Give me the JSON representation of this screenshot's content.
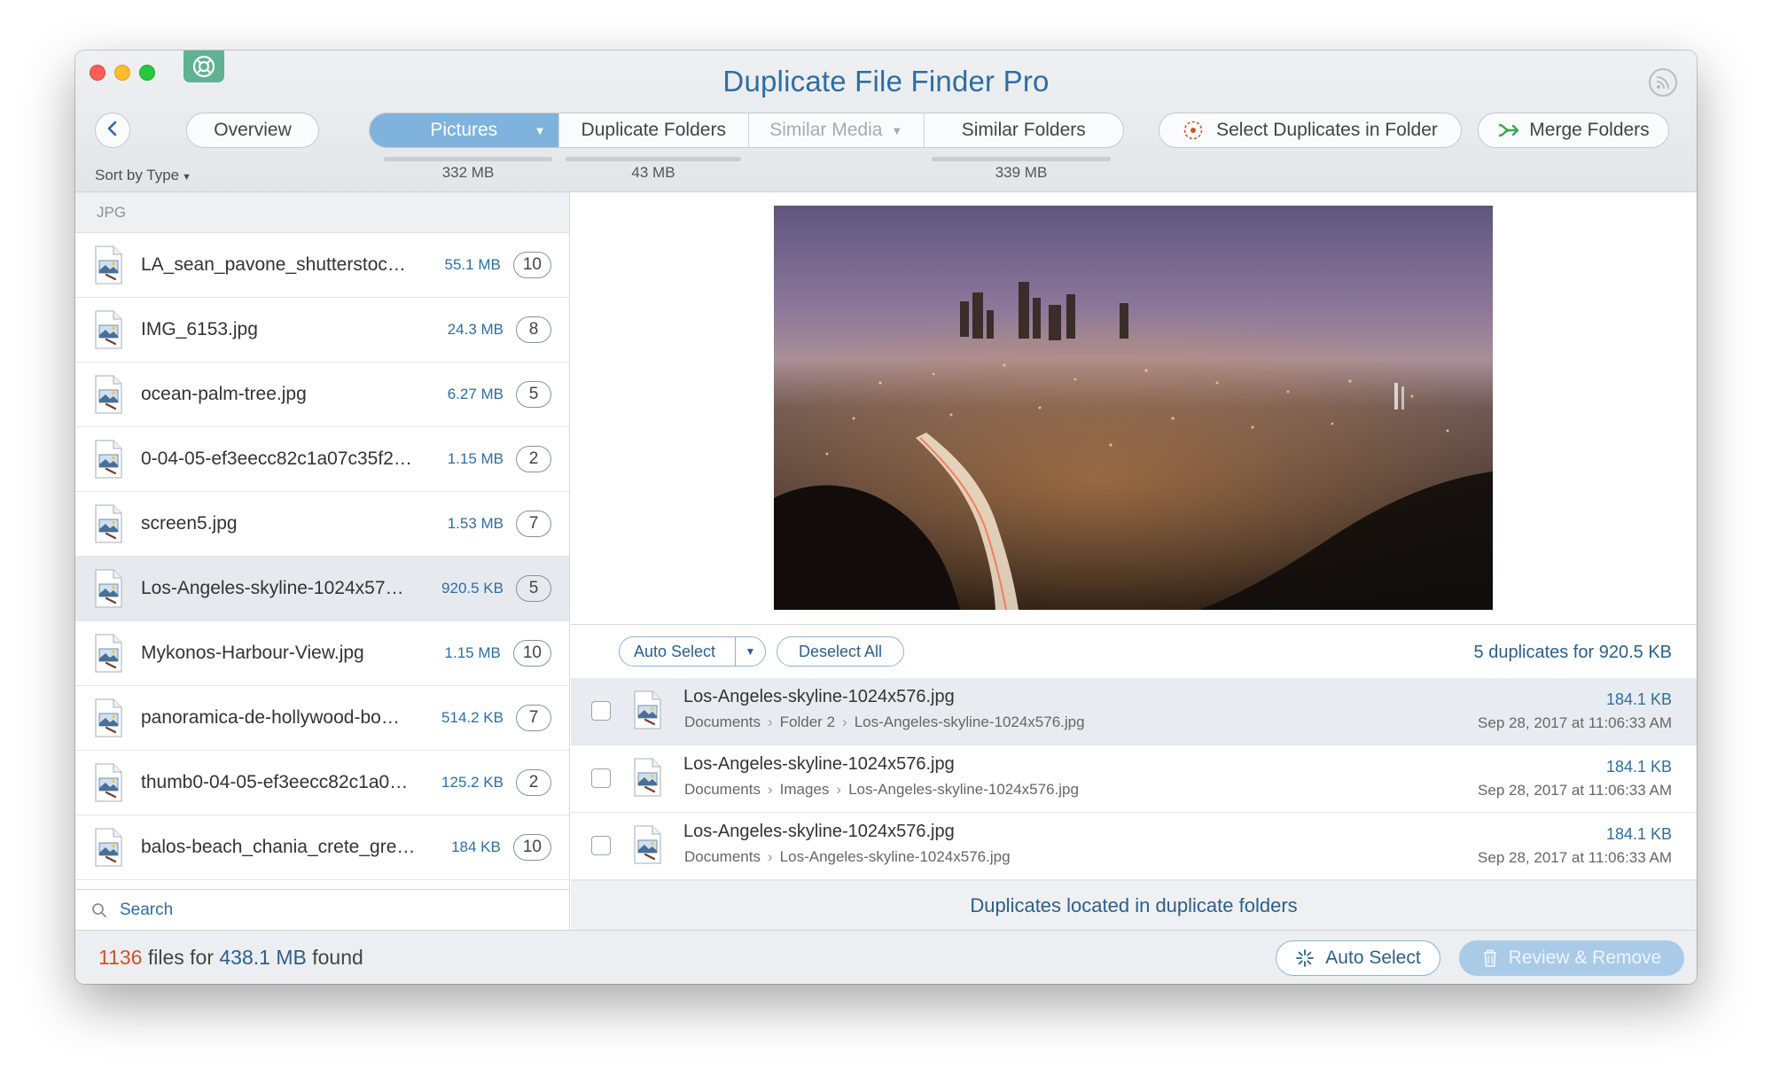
{
  "app": {
    "title": "Duplicate File Finder Pro"
  },
  "toolbar": {
    "overview_label": "Overview",
    "sort_label": "Sort by Type",
    "tabs": [
      {
        "label": "Pictures",
        "size": "332 MB",
        "has_dropdown": true,
        "state": "active"
      },
      {
        "label": "Duplicate Folders",
        "size": "43 MB",
        "has_dropdown": false,
        "state": "normal"
      },
      {
        "label": "Similar Media",
        "size": "",
        "has_dropdown": true,
        "state": "disabled"
      },
      {
        "label": "Similar Folders",
        "size": "339 MB",
        "has_dropdown": false,
        "state": "normal"
      }
    ],
    "select_duplicates_label": "Select Duplicates in Folder",
    "merge_folders_label": "Merge Folders"
  },
  "file_list": {
    "group_label": "JPG",
    "items": [
      {
        "name": "LA_sean_pavone_shutterstoc…",
        "size": "55.1 MB",
        "count": "10"
      },
      {
        "name": "IMG_6153.jpg",
        "size": "24.3 MB",
        "count": "8"
      },
      {
        "name": "ocean-palm-tree.jpg",
        "size": "6.27 MB",
        "count": "5"
      },
      {
        "name": "0-04-05-ef3eecc82c1a07c35f2…",
        "size": "1.15 MB",
        "count": "2"
      },
      {
        "name": "screen5.jpg",
        "size": "1.53 MB",
        "count": "7"
      },
      {
        "name": "Los-Angeles-skyline-1024x57…",
        "size": "920.5 KB",
        "count": "5"
      },
      {
        "name": "Mykonos-Harbour-View.jpg",
        "size": "1.15 MB",
        "count": "10"
      },
      {
        "name": "panoramica-de-hollywood-bo…",
        "size": "514.2 KB",
        "count": "7"
      },
      {
        "name": "thumb0-04-05-ef3eecc82c1a0…",
        "size": "125.2 KB",
        "count": "2"
      },
      {
        "name": "balos-beach_chania_crete_gre…",
        "size": "184 KB",
        "count": "10"
      }
    ],
    "selected_index": 5,
    "search_placeholder": "Search"
  },
  "detail": {
    "auto_select_label": "Auto Select",
    "deselect_all_label": "Deselect All",
    "summary": "5 duplicates for 920.5 KB",
    "duplicates": [
      {
        "name": "Los-Angeles-skyline-1024x576.jpg",
        "path": [
          "Documents",
          "Folder 2",
          "Los-Angeles-skyline-1024x576.jpg"
        ],
        "size": "184.1 KB",
        "date": "Sep 28, 2017 at 11:06:33 AM",
        "checked": false
      },
      {
        "name": "Los-Angeles-skyline-1024x576.jpg",
        "path": [
          "Documents",
          "Images",
          "Los-Angeles-skyline-1024x576.jpg"
        ],
        "size": "184.1 KB",
        "date": "Sep 28, 2017 at 11:06:33 AM",
        "checked": false
      },
      {
        "name": "Los-Angeles-skyline-1024x576.jpg",
        "path": [
          "Documents",
          "Los-Angeles-skyline-1024x576.jpg"
        ],
        "size": "184.1 KB",
        "date": "Sep 28, 2017 at 11:06:33 AM",
        "checked": false
      }
    ],
    "footer_label": "Duplicates located in duplicate folders"
  },
  "status": {
    "count": "1136",
    "middle": " files for ",
    "size": "438.1 MB",
    "suffix": " found",
    "auto_select_label": "Auto Select",
    "review_label": "Review & Remove"
  },
  "colors": {
    "accent": "#2e6da4",
    "active_tab": "#7fb2dc",
    "count_highlight": "#d0532c",
    "review_button": "#a9cbe7"
  }
}
